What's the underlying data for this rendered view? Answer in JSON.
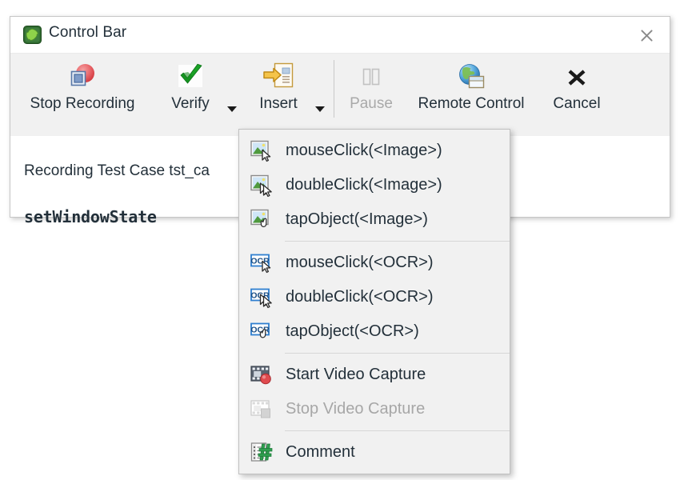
{
  "window": {
    "title": "Control Bar",
    "title_icon": "squish-frog-icon",
    "close_icon": "close-icon"
  },
  "toolbar": {
    "items": [
      {
        "label": "Stop Recording",
        "icon": "stop-recording-icon",
        "disabled": false,
        "has_caret": false
      },
      {
        "label": "Verify",
        "icon": "verify-check-icon",
        "disabled": false,
        "has_caret": true
      },
      {
        "label": "Insert",
        "icon": "insert-arrow-icon",
        "disabled": false,
        "has_caret": true
      },
      {
        "label": "Pause",
        "icon": "pause-icon",
        "disabled": true,
        "has_caret": false
      },
      {
        "label": "Remote Control",
        "icon": "globe-window-icon",
        "disabled": false,
        "has_caret": false
      },
      {
        "label": "Cancel",
        "icon": "cancel-x-icon",
        "disabled": false,
        "has_caret": false
      }
    ]
  },
  "body": {
    "recording_line": "Recording Test Case tst_ca",
    "state_line": "setWindowState"
  },
  "menu": {
    "groups": [
      {
        "items": [
          {
            "label": "mouseClick(<Image>)",
            "icon": "image-mouseclick-icon",
            "disabled": false
          },
          {
            "label": "doubleClick(<Image>)",
            "icon": "image-doubleclick-icon",
            "disabled": false
          },
          {
            "label": "tapObject(<Image>)",
            "icon": "image-tapobject-icon",
            "disabled": false
          }
        ]
      },
      {
        "items": [
          {
            "label": "mouseClick(<OCR>)",
            "icon": "ocr-mouseclick-icon",
            "disabled": false
          },
          {
            "label": "doubleClick(<OCR>)",
            "icon": "ocr-doubleclick-icon",
            "disabled": false
          },
          {
            "label": "tapObject(<OCR>)",
            "icon": "ocr-tapobject-icon",
            "disabled": false
          }
        ]
      },
      {
        "items": [
          {
            "label": "Start Video Capture",
            "icon": "start-video-capture-icon",
            "disabled": false
          },
          {
            "label": "Stop Video Capture",
            "icon": "stop-video-capture-icon",
            "disabled": true
          }
        ]
      },
      {
        "items": [
          {
            "label": "Comment",
            "icon": "comment-hash-icon",
            "disabled": false
          }
        ]
      }
    ]
  },
  "colors": {
    "window_bg": "#ffffff",
    "toolbar_bg": "#f1f1f1",
    "menu_bg": "#f1f1f1",
    "text": "#23303a",
    "disabled_text": "#a7a7a7",
    "record_red": "#e8565a",
    "verify_green": "#18a020",
    "insert_orange": "#e8a020",
    "ocr_blue": "#2f7fd0"
  }
}
